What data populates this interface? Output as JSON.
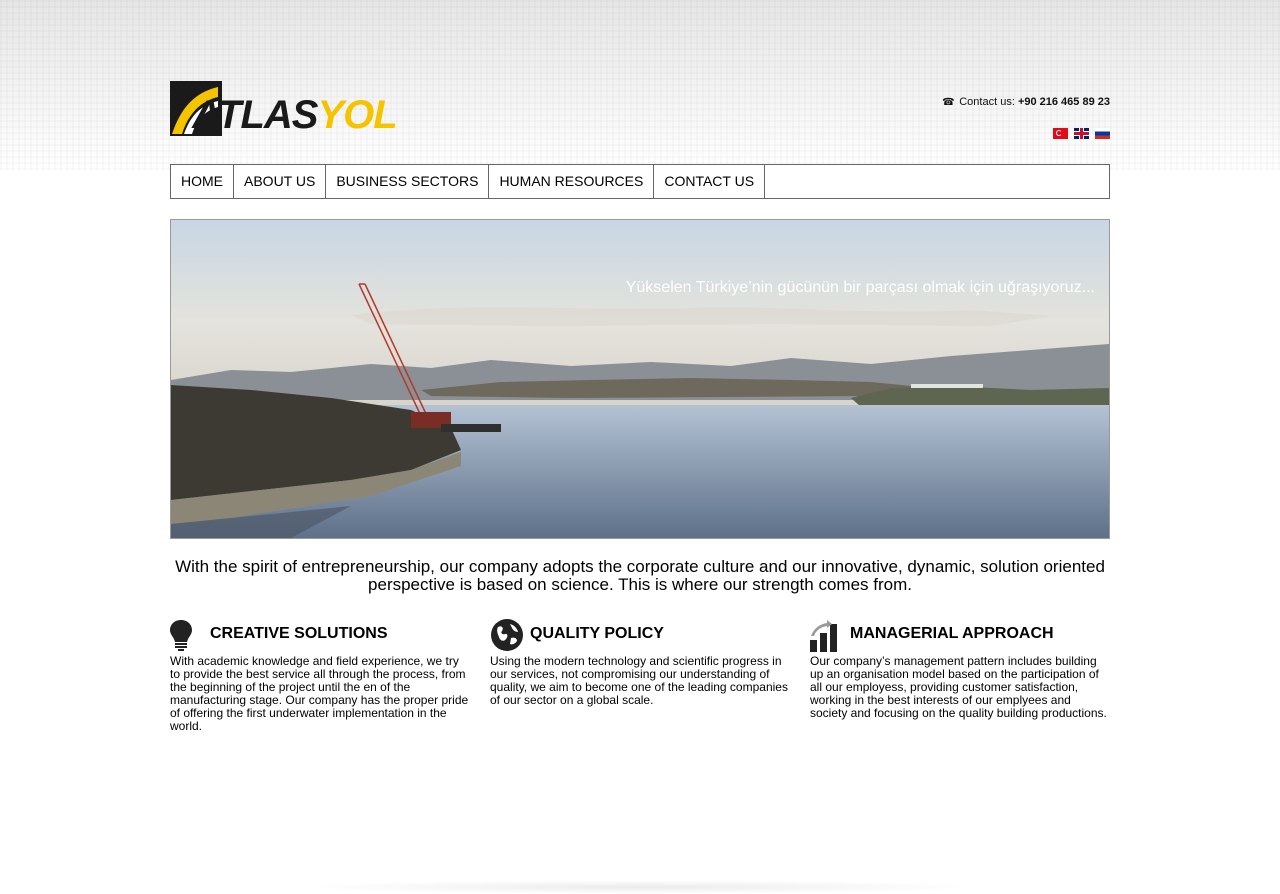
{
  "logo": {
    "part1": "ATLAS",
    "part2": "YOL",
    "mark_colors": {
      "dark": "#1a1a1a",
      "accent": "#f5c400"
    }
  },
  "header": {
    "contact_label": "Contact us:",
    "phone": "+90 216 465 89 23",
    "phone_icon": "phone-icon",
    "languages": [
      "Türkçe",
      "English",
      "Русский"
    ]
  },
  "nav": {
    "items": [
      {
        "label": "HOME"
      },
      {
        "label": "ABOUT US"
      },
      {
        "label": "BUSINESS SECTORS"
      },
      {
        "label": "HUMAN RESOURCES"
      },
      {
        "label": "CONTACT US"
      }
    ]
  },
  "banner": {
    "caption": "Yükselen Türkiye’nin gücünün bir parçası olmak için uğraşıyoruz..."
  },
  "intro": "With the spirit of entrepreneurship, our company adopts the corporate culture and our innovative, dynamic, solution oriented perspective is based on science. This is where our strength comes from.",
  "features": [
    {
      "icon": "lightbulb-icon",
      "title": "CREATIVE SOLUTIONS",
      "text": "With academic knowledge and field experience, we try to provide the best service all through the process, from the beginning of the project until the en of the manufacturing stage. Our company has the proper pride of offering the first underwater implementation in the world."
    },
    {
      "icon": "globe-icon",
      "title": "QUALITY POLICY",
      "text": "Using the modern technology and scientific progress in our services, not compromising our understanding of quality, we aim to become one of the leading companies of our sector on a global scale."
    },
    {
      "icon": "bar-chart-icon",
      "title": "MANAGERIAL APPROACH",
      "text": "Our company’s management pattern includes building up an organisation model based on the participation of all our employess, providing customer satisfaction, working in the best interests of our emplyees and society and focusing on the quality building productions."
    }
  ]
}
